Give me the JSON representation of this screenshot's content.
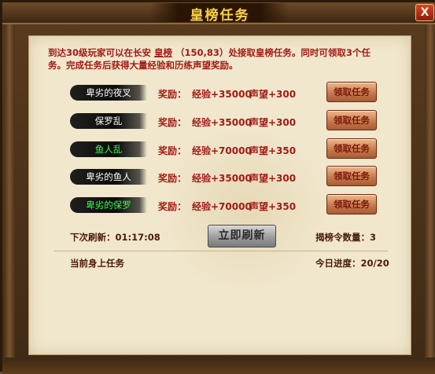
{
  "window": {
    "title": "皇榜任务",
    "close_label": "X"
  },
  "description": {
    "text_before": "到达30级玩家可以在长安",
    "npc_link": "皇榜",
    "coords": "（150,83）",
    "text_after": "处接取皇榜任务。同时可领取3个任务。完成任务后获得大量经验和历练声望奖励。"
  },
  "quests": [
    {
      "name": "卑劣的夜叉",
      "name_color": "white",
      "reward_label": "奖励：",
      "exp": "经验+35000",
      "rep": "声望+300",
      "button": "领取任务"
    },
    {
      "name": "保罗乱",
      "name_color": "white",
      "reward_label": "奖励：",
      "exp": "经验+35000",
      "rep": "声望+300",
      "button": "领取任务"
    },
    {
      "name": "鱼人乱",
      "name_color": "green",
      "reward_label": "奖励：",
      "exp": "经验+70000",
      "rep": "声望+350",
      "button": "领取任务"
    },
    {
      "name": "卑劣的鱼人",
      "name_color": "white",
      "reward_label": "奖励：",
      "exp": "经验+35000",
      "rep": "声望+300",
      "button": "领取任务"
    },
    {
      "name": "卑劣的保罗",
      "name_color": "green",
      "reward_label": "奖励：",
      "exp": "经验+70000",
      "rep": "声望+350",
      "button": "领取任务"
    }
  ],
  "footer": {
    "next_refresh": "下次刷新：01:17:08",
    "refresh_button": "立即刷新",
    "token_count": "揭榜令数量：3",
    "current_tasks": "当前身上任务",
    "today_progress": "今日进度：20/20"
  },
  "colors": {
    "accent_red": "#a21a14",
    "title_gold": "#f2d24a",
    "green_name": "#38ff4a",
    "panel_bg": "#f1e7cd"
  }
}
